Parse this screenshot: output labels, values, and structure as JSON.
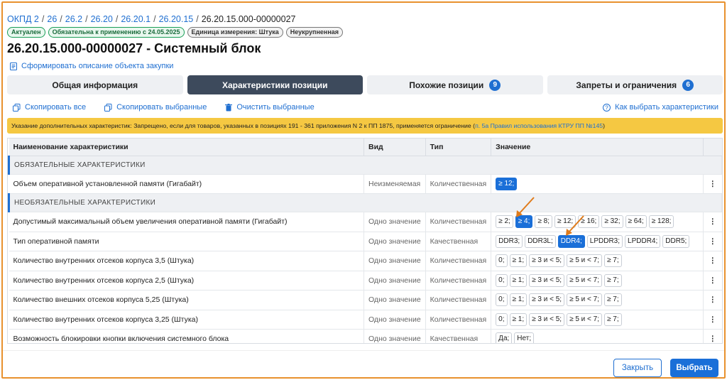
{
  "breadcrumb": {
    "items": [
      "ОКПД 2",
      "26",
      "26.2",
      "26.20",
      "26.20.1",
      "26.20.15"
    ],
    "current": "26.20.15.000-00000027"
  },
  "badges": [
    "Актуален",
    "Обязательна к применению с 24.05.2025",
    "Единица измерения: Штука",
    "Неукрупненная"
  ],
  "page_title": "26.20.15.000-00000027 - Системный блок",
  "generate_link": "Сформировать описание объекта закупки",
  "tabs": [
    {
      "label": "Общая информация",
      "count": ""
    },
    {
      "label": "Характеристики позиции",
      "count": ""
    },
    {
      "label": "Похожие позиции",
      "count": "9"
    },
    {
      "label": "Запреты и ограничения",
      "count": "6"
    }
  ],
  "actions": {
    "copy_all": "Скопировать все",
    "copy_selected": "Скопировать выбранные",
    "clear_selected": "Очистить выбранные",
    "how_to_choose": "Как выбрать характеристики"
  },
  "notice": {
    "text": "Указание дополнительных характеристик: Запрещено, если для товаров, указанных в позициях 191 - 361 приложения N 2 к ПП 1875, применяется ограничение (",
    "link": "п. 5а Правил использования КТРУ ПП №145",
    "suffix": ")"
  },
  "table": {
    "headers": [
      "Наименование характеристики",
      "Вид",
      "Тип",
      "Значение"
    ],
    "section_required": "ОБЯЗАТЕЛЬНЫЕ ХАРАКТЕРИСТИКИ",
    "section_optional": "НЕОБЯЗАТЕЛЬНЫЕ ХАРАКТЕРИСТИКИ",
    "required_rows": [
      {
        "name": "Объем оперативной установленной памяти (Гигабайт)",
        "kind": "Неизменяемая",
        "type": "Количественная",
        "values": [
          {
            "v": "≥ 12;",
            "sel": true
          }
        ]
      }
    ],
    "optional_rows": [
      {
        "name": "Допустимый максимальный объем увеличения оперативной памяти (Гигабайт)",
        "kind": "Одно значение",
        "type": "Количественная",
        "values": [
          {
            "v": "≥ 2;",
            "sel": false
          },
          {
            "v": "≥ 4;",
            "sel": true
          },
          {
            "v": "≥ 8;",
            "sel": false
          },
          {
            "v": "≥ 12;",
            "sel": false
          },
          {
            "v": "≥ 16;",
            "sel": false
          },
          {
            "v": "≥ 32;",
            "sel": false
          },
          {
            "v": "≥ 64;",
            "sel": false
          },
          {
            "v": "≥ 128;",
            "sel": false
          }
        ]
      },
      {
        "name": "Тип оперативной памяти",
        "kind": "Одно значение",
        "type": "Качественная",
        "values": [
          {
            "v": "DDR3;",
            "sel": false
          },
          {
            "v": "DDR3L;",
            "sel": false
          },
          {
            "v": "DDR4;",
            "sel": true
          },
          {
            "v": "LPDDR3;",
            "sel": false
          },
          {
            "v": "LPDDR4;",
            "sel": false
          },
          {
            "v": "DDR5;",
            "sel": false
          }
        ]
      },
      {
        "name": "Количество внутренних отсеков корпуса 3,5 (Штука)",
        "kind": "Одно значение",
        "type": "Количественная",
        "values": [
          {
            "v": "0;",
            "sel": false
          },
          {
            "v": "≥ 1;",
            "sel": false
          },
          {
            "v": "≥ 3 и < 5;",
            "sel": false
          },
          {
            "v": "≥ 5 и < 7;",
            "sel": false
          },
          {
            "v": "≥ 7;",
            "sel": false
          }
        ]
      },
      {
        "name": "Количество внутренних отсеков корпуса 2,5 (Штука)",
        "kind": "Одно значение",
        "type": "Количественная",
        "values": [
          {
            "v": "0;",
            "sel": false
          },
          {
            "v": "≥ 1;",
            "sel": false
          },
          {
            "v": "≥ 3 и < 5;",
            "sel": false
          },
          {
            "v": "≥ 5 и < 7;",
            "sel": false
          },
          {
            "v": "≥ 7;",
            "sel": false
          }
        ]
      },
      {
        "name": "Количество внешних отсеков корпуса 5,25 (Штука)",
        "kind": "Одно значение",
        "type": "Количественная",
        "values": [
          {
            "v": "0;",
            "sel": false
          },
          {
            "v": "≥ 1;",
            "sel": false
          },
          {
            "v": "≥ 3 и < 5;",
            "sel": false
          },
          {
            "v": "≥ 5 и < 7;",
            "sel": false
          },
          {
            "v": "≥ 7;",
            "sel": false
          }
        ]
      },
      {
        "name": "Количество внутренних отсеков корпуса 3,25 (Штука)",
        "kind": "Одно значение",
        "type": "Количественная",
        "values": [
          {
            "v": "0;",
            "sel": false
          },
          {
            "v": "≥ 1;",
            "sel": false
          },
          {
            "v": "≥ 3 и < 5;",
            "sel": false
          },
          {
            "v": "≥ 5 и < 7;",
            "sel": false
          },
          {
            "v": "≥ 7;",
            "sel": false
          }
        ]
      },
      {
        "name": "Возможность блокировки кнопки включения системного блока",
        "kind": "Одно значение",
        "type": "Качественная",
        "values": [
          {
            "v": "Да;",
            "sel": false
          },
          {
            "v": "Нет;",
            "sel": false
          }
        ]
      }
    ]
  },
  "footer": {
    "close": "Закрыть",
    "select": "Выбрать"
  },
  "colors": {
    "accent": "#1a6fd8",
    "notice": "#f5c842",
    "frame": "#e8912d",
    "arrow": "#e07b1a"
  }
}
